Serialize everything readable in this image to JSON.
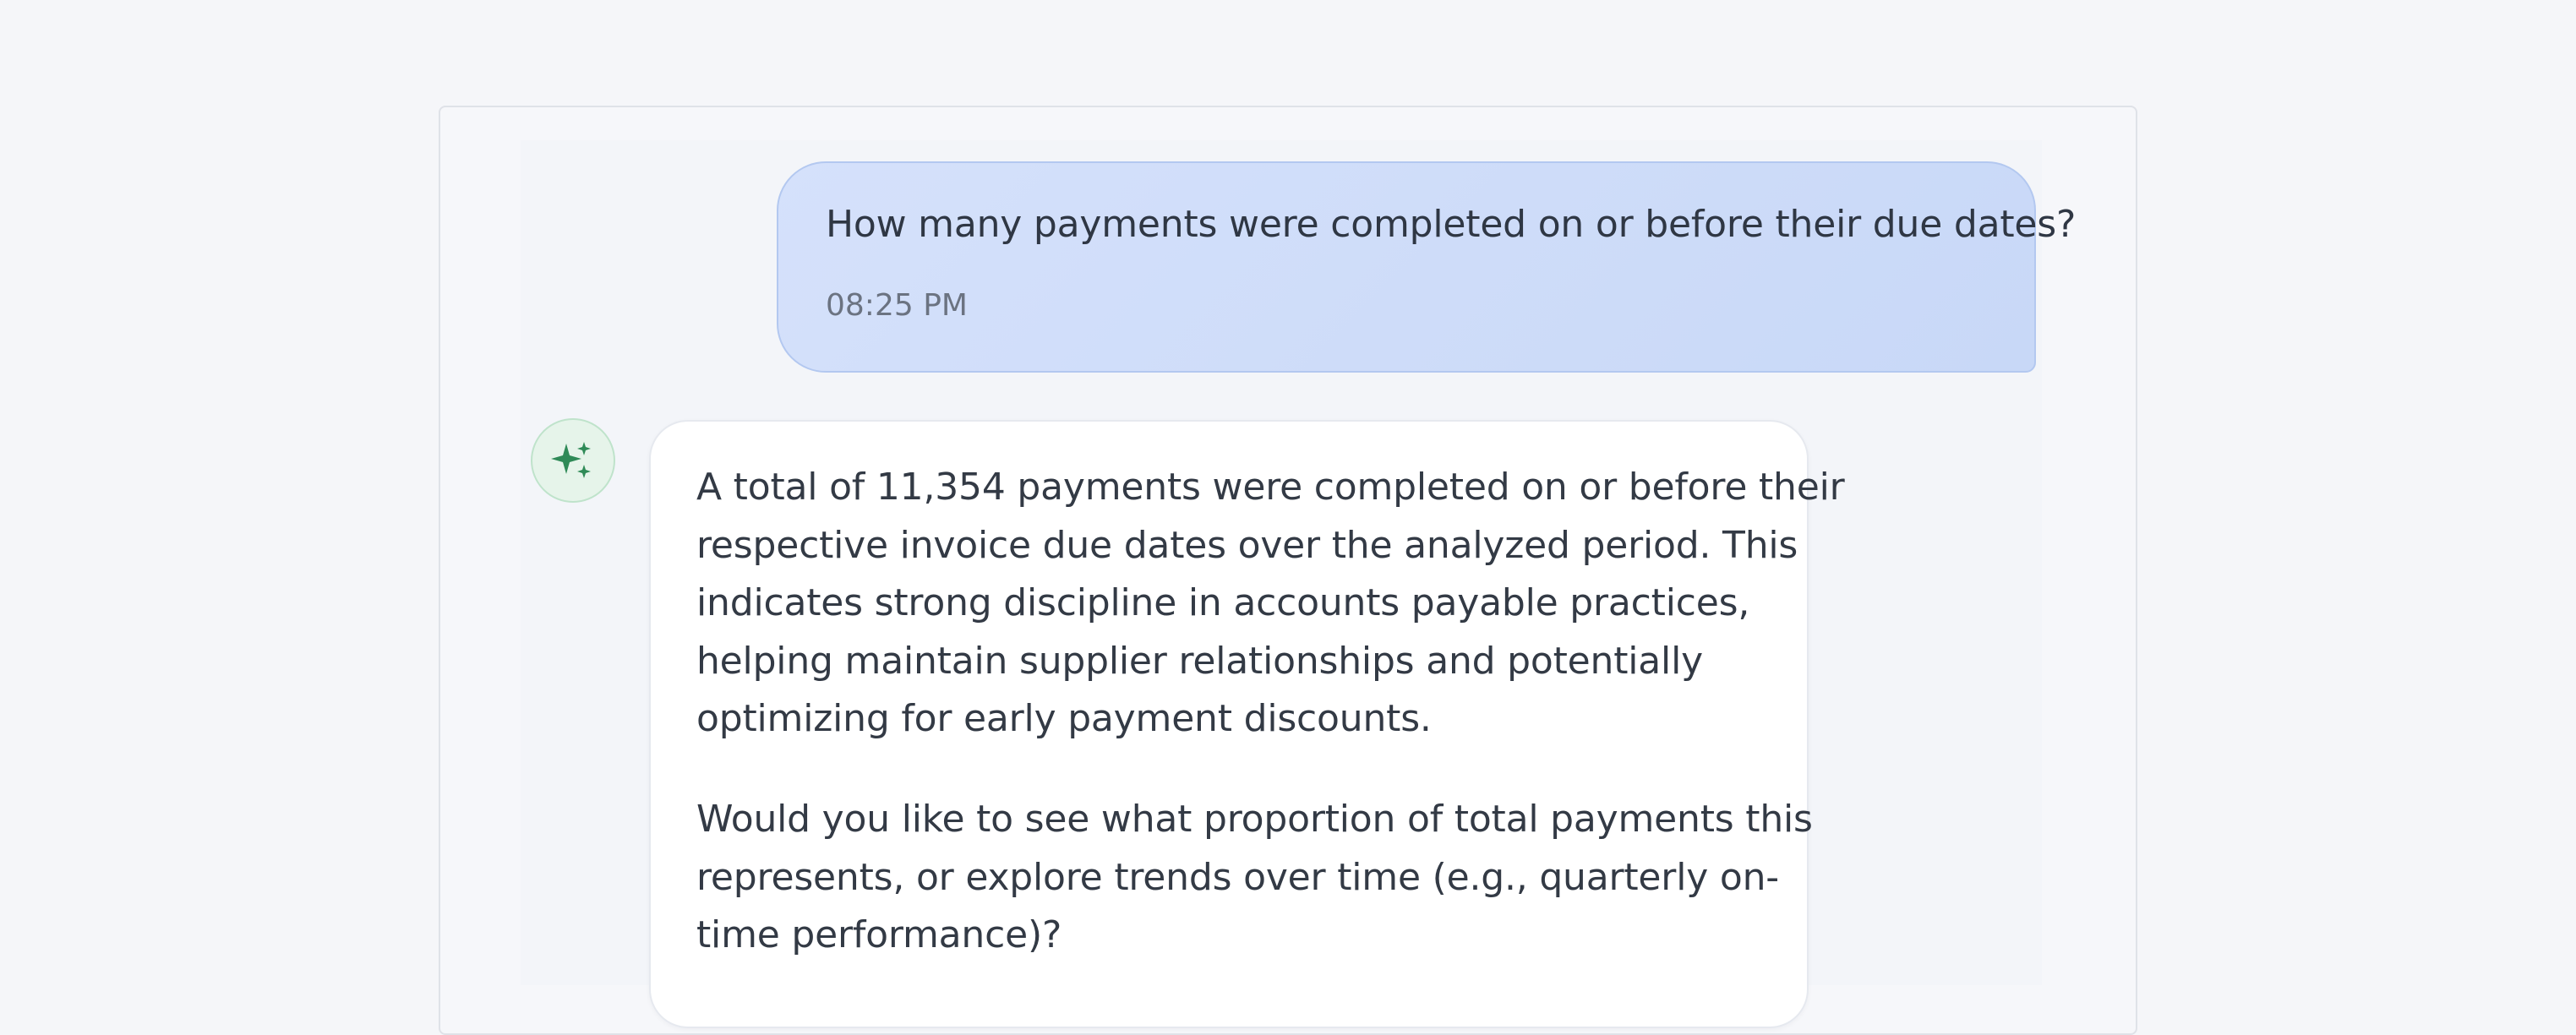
{
  "conversation": {
    "user_message": {
      "text": "How many payments were completed on or before their due dates?",
      "time": "08:25 PM"
    },
    "assistant_message": {
      "avatar_icon": "sparkle-icon",
      "paragraph1_lines": [
        "A total of 11,354 payments were completed on or before their",
        "respective invoice due dates over the analyzed period. This",
        "indicates strong discipline in accounts payable practices,",
        "helping maintain supplier relationships and potentially",
        "optimizing for early payment discounts."
      ],
      "paragraph2_lines": [
        "Would you like to see what proportion of total payments this",
        "represents, or explore trends over time (e.g., quarterly on-",
        "time performance)?"
      ]
    }
  },
  "colors": {
    "user_bubble": "#c8d8f7",
    "avatar_accent": "#2f8a57"
  }
}
